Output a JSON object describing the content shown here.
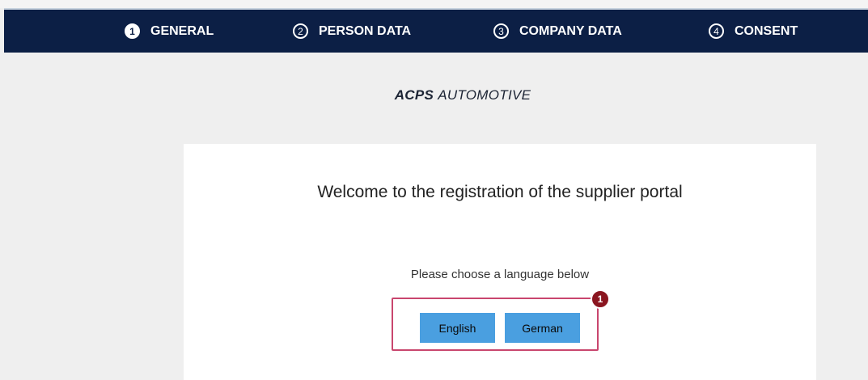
{
  "stepper": {
    "steps": [
      {
        "number": "1",
        "label": "GENERAL",
        "active": true
      },
      {
        "number": "2",
        "label": "PERSON DATA",
        "active": false
      },
      {
        "number": "3",
        "label": "COMPANY DATA",
        "active": false
      },
      {
        "number": "4",
        "label": "CONSENT",
        "active": false
      }
    ],
    "background_color": "#0c1f45"
  },
  "brand": {
    "part1": "ACPS",
    "part2": "AUTOMOTIVE"
  },
  "card": {
    "welcome_text": "Welcome to the registration of the supplier portal",
    "choose_language_text": "Please choose a language below",
    "language_buttons": {
      "english": "English",
      "german": "German"
    },
    "button_color": "#4a9fe0",
    "highlight_color": "#c9466e",
    "annotation_marker": "1",
    "marker_color": "#8b1620"
  }
}
